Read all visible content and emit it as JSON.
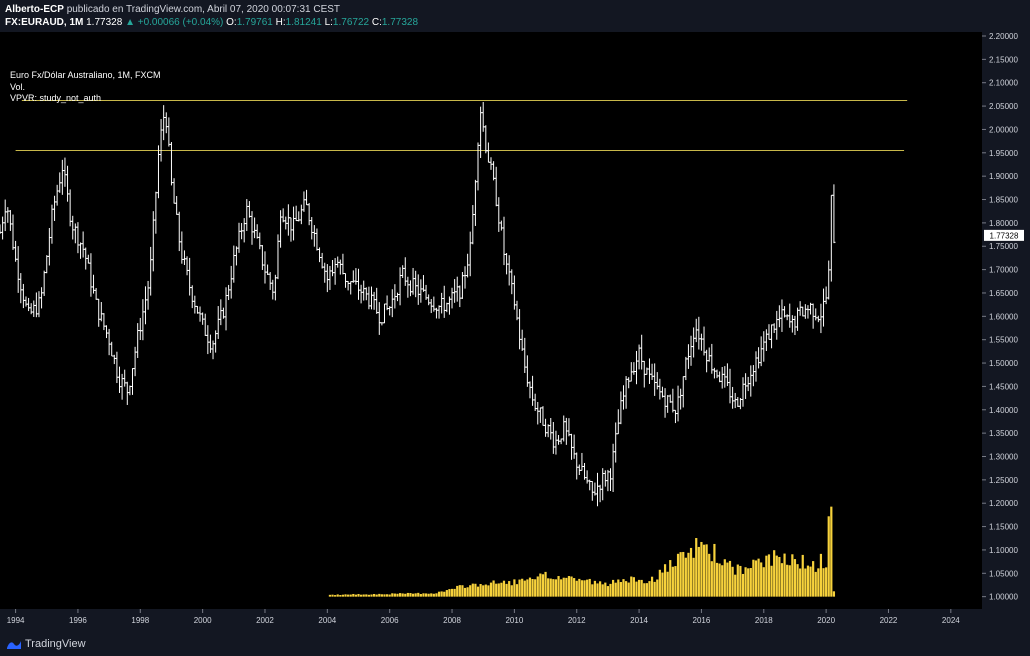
{
  "header": {
    "author": "Alberto-ECP",
    "published": "publicado en TradingView.com, Abril 07, 2020 00:07:31 CEST",
    "symbol": "FX:EURAUD, 1M",
    "last": "1.77328",
    "change": "▲ +0.00066 (+0.04%)",
    "o_label": "O:",
    "o_value": "1.79761",
    "h_label": "H:",
    "h_value": "1.81241",
    "l_label": "L:",
    "l_value": "1.76722",
    "c_label": "C:",
    "c_value": "1.77328"
  },
  "legend": {
    "title": "Euro Fx/Dólar Australiano, 1M, FXCM",
    "vol": "Vol.",
    "vpvr": "VPVR: study_not_auth"
  },
  "footer": {
    "brand": "TradingView"
  },
  "colors": {
    "background": "#000000",
    "axis_panel": "#131722",
    "bars": "#ffffff",
    "volume": "#f7d23c",
    "lines": "#c8b84a",
    "price_tag_bg": "#ffffff"
  },
  "chart_data": {
    "type": "ohlc",
    "title": "Euro Fx/Dólar Australiano, 1M, FXCM",
    "ylim": [
      0.98,
      2.2
    ],
    "y_ticks": [
      "2.20000",
      "2.15000",
      "2.10000",
      "2.05000",
      "2.00000",
      "1.95000",
      "1.90000",
      "1.85000",
      "1.80000",
      "1.75000",
      "1.70000",
      "1.65000",
      "1.60000",
      "1.55000",
      "1.50000",
      "1.45000",
      "1.40000",
      "1.35000",
      "1.30000",
      "1.25000",
      "1.20000",
      "1.15000",
      "1.10000",
      "1.05000",
      "1.00000"
    ],
    "xlim": [
      1993.5,
      2025.0
    ],
    "x_ticks": [
      "1994",
      "1996",
      "1998",
      "2000",
      "2002",
      "2004",
      "2006",
      "2008",
      "2010",
      "2012",
      "2014",
      "2016",
      "2018",
      "2020",
      "2022",
      "2024"
    ],
    "last_price_label": "1.77328",
    "last_price": 1.77328,
    "horizontal_lines": [
      {
        "price": 2.062,
        "from": 1994.2,
        "to": 2022.6
      },
      {
        "price": 1.955,
        "from": 1994.0,
        "to": 2022.5
      }
    ],
    "price_path": [
      [
        1993.5,
        1.78
      ],
      [
        1993.7,
        1.85
      ],
      [
        1994.0,
        1.72
      ],
      [
        1994.4,
        1.6
      ],
      [
        1994.8,
        1.63
      ],
      [
        1995.2,
        1.83
      ],
      [
        1995.5,
        1.92
      ],
      [
        1995.8,
        1.8
      ],
      [
        1996.2,
        1.74
      ],
      [
        1996.6,
        1.62
      ],
      [
        1997.0,
        1.55
      ],
      [
        1997.3,
        1.47
      ],
      [
        1997.6,
        1.44
      ],
      [
        1997.9,
        1.55
      ],
      [
        1998.3,
        1.68
      ],
      [
        1998.6,
        1.96
      ],
      [
        1998.8,
        2.05
      ],
      [
        1999.0,
        1.88
      ],
      [
        1999.3,
        1.74
      ],
      [
        1999.6,
        1.66
      ],
      [
        2000.0,
        1.58
      ],
      [
        2000.3,
        1.54
      ],
      [
        2000.7,
        1.62
      ],
      [
        2001.0,
        1.72
      ],
      [
        2001.4,
        1.83
      ],
      [
        2001.6,
        1.79
      ],
      [
        2002.0,
        1.7
      ],
      [
        2002.3,
        1.65
      ],
      [
        2002.5,
        1.83
      ],
      [
        2002.9,
        1.79
      ],
      [
        2003.3,
        1.84
      ],
      [
        2003.7,
        1.75
      ],
      [
        2004.0,
        1.68
      ],
      [
        2004.3,
        1.72
      ],
      [
        2004.6,
        1.68
      ],
      [
        2005.0,
        1.66
      ],
      [
        2005.3,
        1.64
      ],
      [
        2005.7,
        1.6
      ],
      [
        2006.0,
        1.62
      ],
      [
        2006.4,
        1.69
      ],
      [
        2006.8,
        1.66
      ],
      [
        2007.2,
        1.64
      ],
      [
        2007.6,
        1.62
      ],
      [
        2007.9,
        1.63
      ],
      [
        2008.3,
        1.66
      ],
      [
        2008.6,
        1.75
      ],
      [
        2008.9,
        2.05
      ],
      [
        2009.1,
        1.96
      ],
      [
        2009.4,
        1.86
      ],
      [
        2009.7,
        1.72
      ],
      [
        2010.0,
        1.63
      ],
      [
        2010.3,
        1.5
      ],
      [
        2010.6,
        1.42
      ],
      [
        2010.9,
        1.38
      ],
      [
        2011.3,
        1.33
      ],
      [
        2011.6,
        1.36
      ],
      [
        2011.9,
        1.3
      ],
      [
        2012.2,
        1.26
      ],
      [
        2012.5,
        1.22
      ],
      [
        2012.8,
        1.25
      ],
      [
        2013.1,
        1.27
      ],
      [
        2013.4,
        1.4
      ],
      [
        2013.7,
        1.48
      ],
      [
        2014.0,
        1.52
      ],
      [
        2014.3,
        1.47
      ],
      [
        2014.6,
        1.44
      ],
      [
        2014.9,
        1.42
      ],
      [
        2015.2,
        1.4
      ],
      [
        2015.5,
        1.5
      ],
      [
        2015.8,
        1.58
      ],
      [
        2016.0,
        1.55
      ],
      [
        2016.3,
        1.5
      ],
      [
        2016.6,
        1.47
      ],
      [
        2016.9,
        1.44
      ],
      [
        2017.1,
        1.41
      ],
      [
        2017.4,
        1.46
      ],
      [
        2017.7,
        1.5
      ],
      [
        2018.0,
        1.54
      ],
      [
        2018.3,
        1.58
      ],
      [
        2018.6,
        1.6
      ],
      [
        2018.9,
        1.58
      ],
      [
        2019.2,
        1.61
      ],
      [
        2019.5,
        1.62
      ],
      [
        2019.8,
        1.6
      ],
      [
        2020.0,
        1.64
      ],
      [
        2020.1,
        1.7
      ],
      [
        2020.2,
        1.92
      ],
      [
        2020.25,
        1.77
      ]
    ],
    "volume_path": [
      [
        2004.0,
        0.004
      ],
      [
        2006.0,
        0.006
      ],
      [
        2007.5,
        0.008
      ],
      [
        2008.5,
        0.025
      ],
      [
        2009.5,
        0.03
      ],
      [
        2010.5,
        0.035
      ],
      [
        2011.0,
        0.045
      ],
      [
        2012.0,
        0.04
      ],
      [
        2013.0,
        0.025
      ],
      [
        2013.5,
        0.045
      ],
      [
        2014.0,
        0.03
      ],
      [
        2014.5,
        0.04
      ],
      [
        2015.0,
        0.07
      ],
      [
        2015.5,
        0.085
      ],
      [
        2016.0,
        0.12
      ],
      [
        2016.5,
        0.09
      ],
      [
        2017.0,
        0.06
      ],
      [
        2017.5,
        0.06
      ],
      [
        2018.0,
        0.08
      ],
      [
        2018.5,
        0.085
      ],
      [
        2019.0,
        0.09
      ],
      [
        2019.5,
        0.06
      ],
      [
        2019.9,
        0.08
      ],
      [
        2020.05,
        0.08
      ],
      [
        2020.15,
        0.275
      ],
      [
        2020.25,
        0.015
      ]
    ]
  }
}
